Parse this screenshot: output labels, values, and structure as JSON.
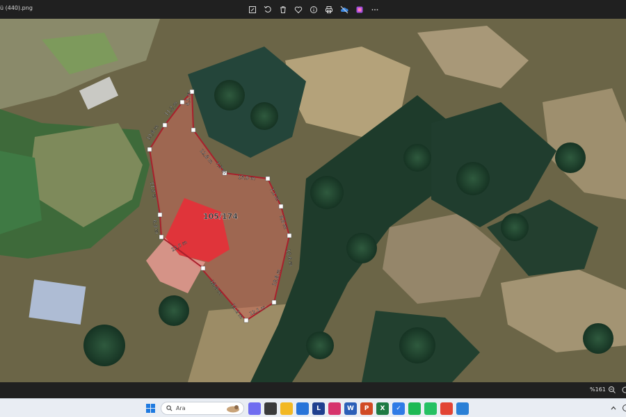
{
  "window": {
    "title": "ü (440).png"
  },
  "toolbar": {
    "buttons": [
      "edit-icon",
      "rotate-icon",
      "delete-icon",
      "favorite-icon",
      "info-icon",
      "print-icon",
      "onedrive-icon",
      "app-icon",
      "more-icon"
    ]
  },
  "map": {
    "area_label": "105/174",
    "segment_labels": [
      "11,2 m",
      "10,6 m",
      "6,1 m",
      "12,8 m",
      "7,3 m",
      "15,9 m",
      "7,1 m",
      "9,6 m",
      "13,6 m",
      "17,2 m",
      "6,9 m",
      "22,0 m",
      "18,8 m",
      "11,2 m",
      "12,1 m",
      "19,8 m"
    ]
  },
  "status": {
    "zoom": "%161"
  },
  "taskbar": {
    "search_placeholder": "Ara",
    "apps": [
      {
        "name": "copilot",
        "label": "",
        "color": "#6f6cf0"
      },
      {
        "name": "taskview",
        "label": "",
        "color": "#3a3a3a"
      },
      {
        "name": "file-explorer",
        "label": "",
        "color": "#f2b824"
      },
      {
        "name": "store",
        "label": "",
        "color": "#2874d9"
      },
      {
        "name": "l-app",
        "label": "L",
        "color": "#1f3f8f"
      },
      {
        "name": "instagram",
        "label": "",
        "color": "#d6336c"
      },
      {
        "name": "word",
        "label": "W",
        "color": "#2b5fb8"
      },
      {
        "name": "powerpoint",
        "label": "P",
        "color": "#d14a24"
      },
      {
        "name": "excel",
        "label": "X",
        "color": "#1d7a43"
      },
      {
        "name": "todo",
        "label": "✓",
        "color": "#2f7be6"
      },
      {
        "name": "spotify",
        "label": "",
        "color": "#1db954"
      },
      {
        "name": "whatsapp",
        "label": "",
        "color": "#25c163"
      },
      {
        "name": "chrome",
        "label": "",
        "color": "#e24434"
      },
      {
        "name": "photos",
        "label": "",
        "color": "#2b80d6"
      }
    ]
  }
}
